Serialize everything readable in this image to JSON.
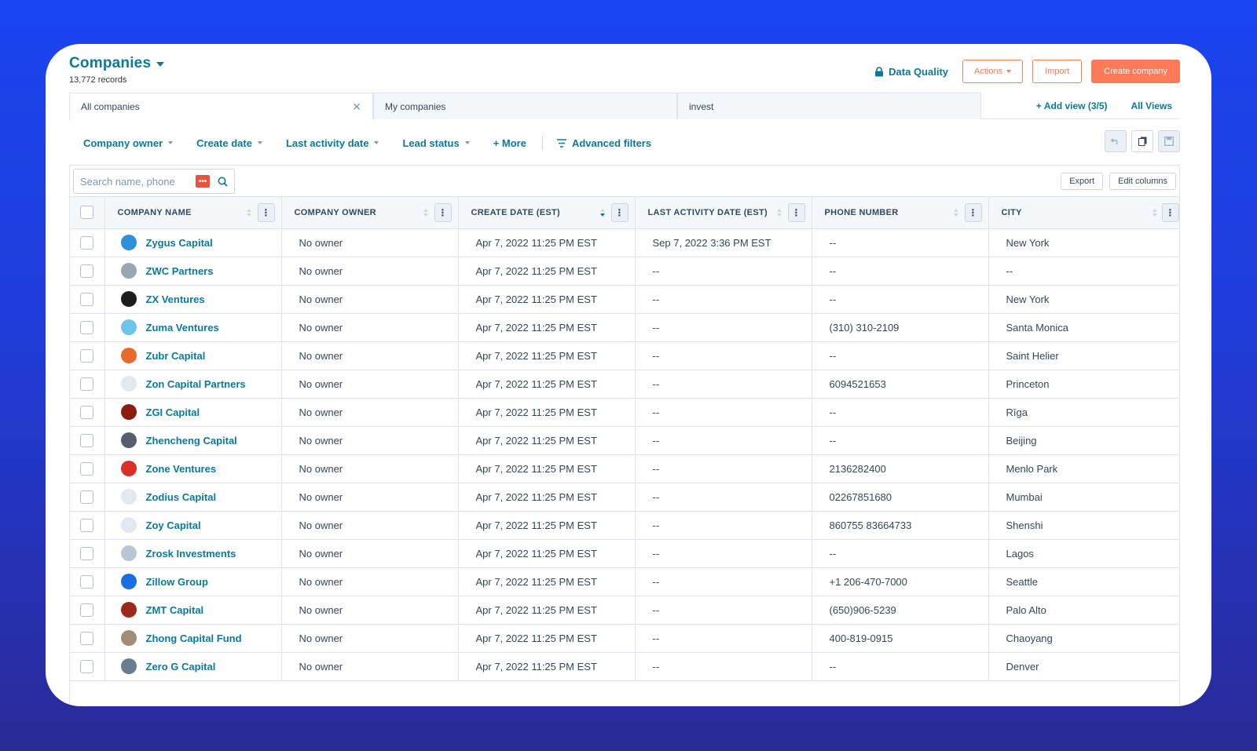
{
  "header": {
    "title": "Companies",
    "records": "13,772 records",
    "data_quality": "Data Quality",
    "actions": "Actions",
    "import": "Import",
    "create": "Create company"
  },
  "tabs": {
    "all": "All companies",
    "mine": "My companies",
    "invest": "invest",
    "add_view": "+ Add view (3/5)",
    "all_views": "All Views"
  },
  "filters": {
    "owner": "Company owner",
    "create_date": "Create date",
    "last_activity": "Last activity date",
    "lead_status": "Lead status",
    "more": "+ More",
    "advanced": "Advanced filters"
  },
  "toolbar": {
    "search_placeholder": "Search name, phone",
    "export": "Export",
    "edit_columns": "Edit columns"
  },
  "columns": [
    "COMPANY NAME",
    "COMPANY OWNER",
    "CREATE DATE (EST)",
    "LAST ACTIVITY DATE (EST)",
    "PHONE NUMBER",
    "CITY"
  ],
  "rows": [
    {
      "name": "Zygus Capital",
      "owner": "No owner",
      "created": "Apr 7, 2022 11:25 PM EST",
      "activity": "Sep 7, 2022 3:36 PM EST",
      "phone": "--",
      "city": "New York",
      "logo_color": "#2f8fd8"
    },
    {
      "name": "ZWC Partners",
      "owner": "No owner",
      "created": "Apr 7, 2022 11:25 PM EST",
      "activity": "--",
      "phone": "--",
      "city": "--",
      "logo_color": "#9aa6b2"
    },
    {
      "name": "ZX Ventures",
      "owner": "No owner",
      "created": "Apr 7, 2022 11:25 PM EST",
      "activity": "--",
      "phone": "--",
      "city": "New York",
      "logo_color": "#1d1d1d"
    },
    {
      "name": "Zuma Ventures",
      "owner": "No owner",
      "created": "Apr 7, 2022 11:25 PM EST",
      "activity": "--",
      "phone": "(310) 310-2109",
      "city": "Santa Monica",
      "logo_color": "#6ec4e8"
    },
    {
      "name": "Zubr Capital",
      "owner": "No owner",
      "created": "Apr 7, 2022 11:25 PM EST",
      "activity": "--",
      "phone": "--",
      "city": "Saint Helier",
      "logo_color": "#e86a2a"
    },
    {
      "name": "Zon Capital Partners",
      "owner": "No owner",
      "created": "Apr 7, 2022 11:25 PM EST",
      "activity": "--",
      "phone": "6094521653",
      "city": "Princeton",
      "logo_color": "#e3e8ee"
    },
    {
      "name": "ZGI Capital",
      "owner": "No owner",
      "created": "Apr 7, 2022 11:25 PM EST",
      "activity": "--",
      "phone": "--",
      "city": "Rīga",
      "logo_color": "#8a1c10"
    },
    {
      "name": "Zhencheng Capital",
      "owner": "No owner",
      "created": "Apr 7, 2022 11:25 PM EST",
      "activity": "--",
      "phone": "--",
      "city": "Beijing",
      "logo_color": "#555f6b"
    },
    {
      "name": "Zone Ventures",
      "owner": "No owner",
      "created": "Apr 7, 2022 11:25 PM EST",
      "activity": "--",
      "phone": "2136282400",
      "city": "Menlo Park",
      "logo_color": "#d9302a"
    },
    {
      "name": "Zodius Capital",
      "owner": "No owner",
      "created": "Apr 7, 2022 11:25 PM EST",
      "activity": "--",
      "phone": "02267851680",
      "city": "Mumbai",
      "logo_color": "#e3e8ee"
    },
    {
      "name": "Zoy Capital",
      "owner": "No owner",
      "created": "Apr 7, 2022 11:25 PM EST",
      "activity": "--",
      "phone": "860755 83664733",
      "city": "Shenshi",
      "logo_color": "#e3e8ee"
    },
    {
      "name": "Zrosk Investments",
      "owner": "No owner",
      "created": "Apr 7, 2022 11:25 PM EST",
      "activity": "--",
      "phone": "--",
      "city": "Lagos",
      "logo_color": "#b9c6d3"
    },
    {
      "name": "Zillow Group",
      "owner": "No owner",
      "created": "Apr 7, 2022 11:25 PM EST",
      "activity": "--",
      "phone": "+1 206-470-7000",
      "city": "Seattle",
      "logo_color": "#1a6fe0"
    },
    {
      "name": "ZMT Capital",
      "owner": "No owner",
      "created": "Apr 7, 2022 11:25 PM EST",
      "activity": "--",
      "phone": "(650)906-5239",
      "city": "Palo Alto",
      "logo_color": "#9c2a1c"
    },
    {
      "name": "Zhong Capital Fund",
      "owner": "No owner",
      "created": "Apr 7, 2022 11:25 PM EST",
      "activity": "--",
      "phone": "400-819-0915",
      "city": "Chaoyang",
      "logo_color": "#a08f7a"
    },
    {
      "name": "Zero G Capital",
      "owner": "No owner",
      "created": "Apr 7, 2022 11:25 PM EST",
      "activity": "--",
      "phone": "--",
      "city": "Denver",
      "logo_color": "#6b7c8d"
    }
  ]
}
